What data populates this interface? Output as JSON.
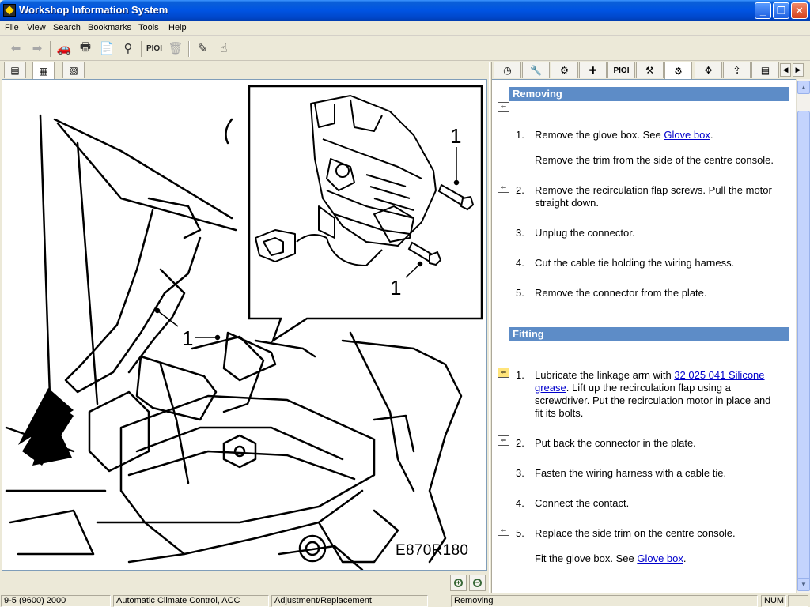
{
  "window": {
    "title": "Workshop Information System"
  },
  "menu": [
    "File",
    "View",
    "Search",
    "Bookmarks",
    "Tools",
    "Help"
  ],
  "toolbar": {
    "pio_label": "PIOI"
  },
  "right_tabs": {
    "pio_label": "PIOI"
  },
  "illustration": {
    "figure_code": "E870R180",
    "callout_label": "1"
  },
  "sections": {
    "removing": {
      "title": "Removing",
      "steps": [
        {
          "num": "1.",
          "text": "Remove the glove box. See ",
          "link": "Glove box",
          "suffix": "."
        },
        {
          "text": "Remove the trim from the side of the centre console."
        },
        {
          "num": "2.",
          "text": "Remove the recirculation flap screws. Pull the motor straight down."
        },
        {
          "num": "3.",
          "text": "Unplug the connector."
        },
        {
          "num": "4.",
          "text": "Cut the cable tie holding the wiring harness."
        },
        {
          "num": "5.",
          "text": "Remove the connector from the plate."
        }
      ]
    },
    "fitting": {
      "title": "Fitting",
      "steps": [
        {
          "num": "1.",
          "text": "Lubricate the linkage arm with ",
          "link": "32 025 041 Silicone grease",
          "suffix": ". Lift up the recirculation flap using a screwdriver. Put the recirculation motor in place and fit its bolts."
        },
        {
          "num": "2.",
          "text": "Put back the connector in the plate."
        },
        {
          "num": "3.",
          "text": "Fasten the wiring harness with a cable tie."
        },
        {
          "num": "4.",
          "text": "Connect the contact."
        },
        {
          "num": "5.",
          "text": "Replace the side trim on the centre console."
        },
        {
          "text": "Fit the glove box. See ",
          "link": "Glove box",
          "suffix": "."
        }
      ]
    }
  },
  "status": {
    "model": "9-5 (9600) 2000",
    "system": "Automatic Climate Control, ACC",
    "procedure": "Adjustment/Replacement",
    "section": "Removing",
    "num": "NUM"
  }
}
